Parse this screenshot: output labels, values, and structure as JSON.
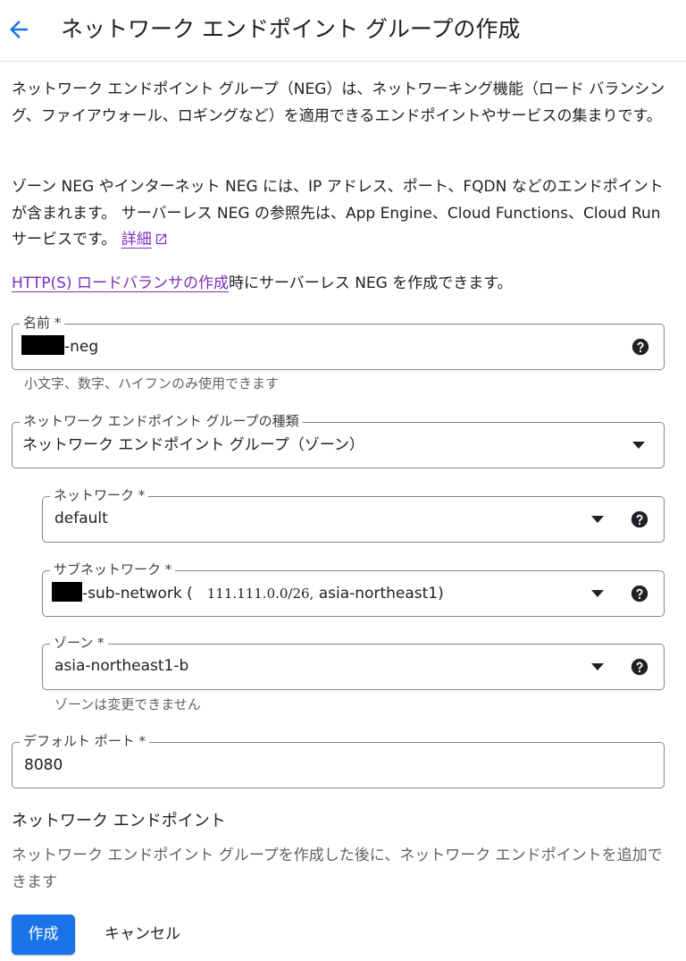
{
  "header": {
    "title": "ネットワーク エンドポイント グループの作成"
  },
  "intro": {
    "p1": "ネットワーク エンドポイント グループ（NEG）は、ネットワーキング機能（ロード バランシング、ファイアウォール、ロギングなど）を適用できるエンドポイントやサービスの集まりです。",
    "p2": "ゾーン NEG やインターネット NEG には、IP アドレス、ポート、FQDN などのエンドポイントが含まれます。 サーバーレス NEG の参照先は、App Engine、Cloud Functions、Cloud Run サービスです。 ",
    "p2_link": "詳細",
    "p3_link": "HTTP(S) ロードバランサの作成",
    "p3_rest": "時にサーバーレス NEG を作成できます。"
  },
  "form": {
    "name": {
      "label": "名前 *",
      "value": "-neg",
      "hint": "小文字、数字、ハイフンのみ使用できます"
    },
    "neg_type": {
      "label": "ネットワーク エンドポイント グループの種類",
      "value": "ネットワーク エンドポイント グループ（ゾーン）"
    },
    "network": {
      "label": "ネットワーク *",
      "value": "default"
    },
    "subnetwork": {
      "label": "サブネットワーク *",
      "value_prefix": "-sub-network (",
      "value_cidr": "111.111.0.0/26,",
      "value_region": "asia-northeast1)"
    },
    "zone": {
      "label": "ゾーン *",
      "value": "asia-northeast1-b",
      "hint": "ゾーンは変更できません"
    },
    "default_port": {
      "label": "デフォルト ポート *",
      "value": "8080"
    }
  },
  "endpoints": {
    "title": "ネットワーク エンドポイント",
    "desc": "ネットワーク エンドポイント グループを作成した後に、ネットワーク エンドポイントを追加できます"
  },
  "actions": {
    "create": "作成",
    "cancel": "キャンセル"
  },
  "colors": {
    "primary": "#1a73e8",
    "link": "#7b2fb8",
    "border": "#80868b"
  }
}
